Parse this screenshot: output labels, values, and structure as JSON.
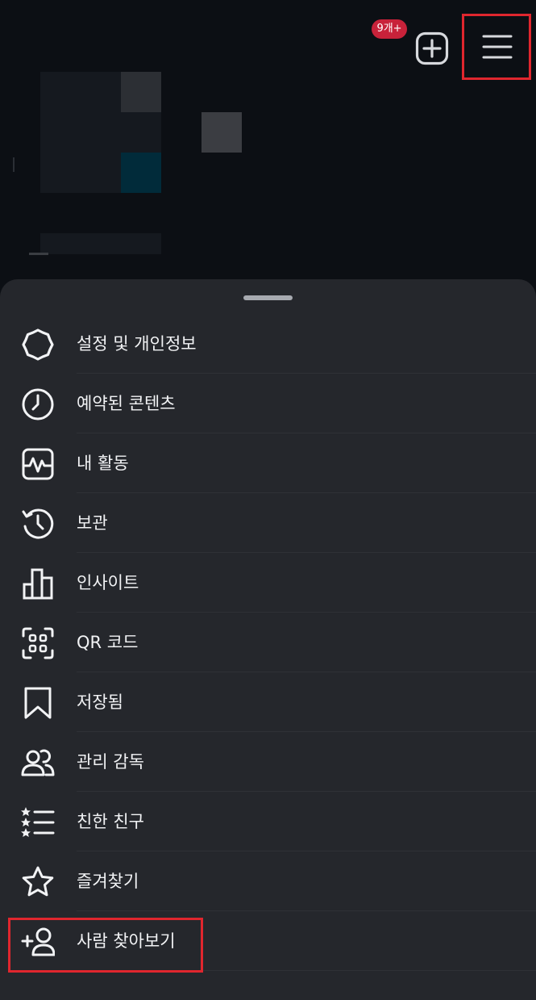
{
  "header": {
    "badge_text": "9개+",
    "icons": [
      "add-icon",
      "hamburger-menu-icon"
    ]
  },
  "menu": {
    "items": [
      {
        "label": "설정 및 개인정보",
        "icon": "settings-gear-icon"
      },
      {
        "label": "예약된 콘텐츠",
        "icon": "clock-icon"
      },
      {
        "label": "내 활동",
        "icon": "activity-icon"
      },
      {
        "label": "보관",
        "icon": "archive-history-icon"
      },
      {
        "label": "인사이트",
        "icon": "bar-chart-icon"
      },
      {
        "label": "QR 코드",
        "icon": "qr-code-icon"
      },
      {
        "label": "저장됨",
        "icon": "bookmark-icon"
      },
      {
        "label": "관리 감독",
        "icon": "supervision-icon"
      },
      {
        "label": "친한 친구",
        "icon": "close-friends-list-icon"
      },
      {
        "label": "즐겨찾기",
        "icon": "star-icon"
      },
      {
        "label": "사람 찾아보기",
        "icon": "add-person-icon"
      }
    ]
  },
  "colors": {
    "background": "#0c0f14",
    "sheet": "#25272c",
    "highlight": "#e0262e",
    "badge": "#c8223a"
  }
}
